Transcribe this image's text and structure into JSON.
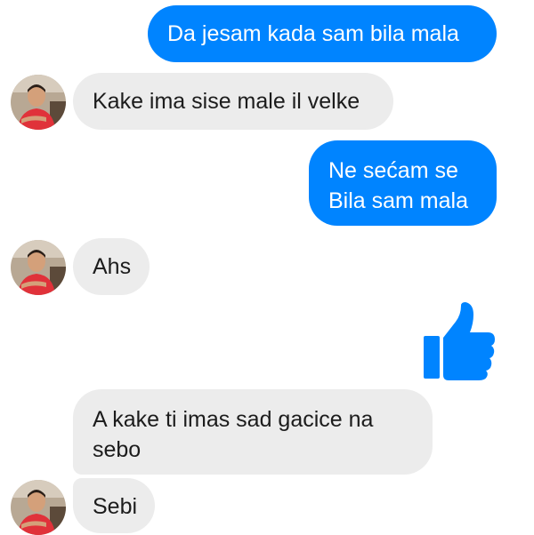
{
  "messages": [
    {
      "side": "sent",
      "text": "Da jesam kada sam bila mala"
    },
    {
      "side": "received",
      "text": "Kake ima sise male il velke",
      "avatar": "contact-avatar"
    },
    {
      "side": "sent",
      "lines": [
        "Ne sećam se",
        "Bila sam mala"
      ]
    },
    {
      "side": "received",
      "text": "Ahs",
      "avatar": "contact-avatar"
    },
    {
      "side": "sent",
      "icon": "thumbs-up-icon"
    },
    {
      "side": "received",
      "text": "A kake ti imas sad gacice na sebo"
    },
    {
      "side": "received",
      "text": "Sebi",
      "avatar": "contact-avatar"
    }
  ],
  "colors": {
    "sent_bubble": "#0084ff",
    "received_bubble": "#ececec",
    "thumbs_up": "#0084ff"
  }
}
